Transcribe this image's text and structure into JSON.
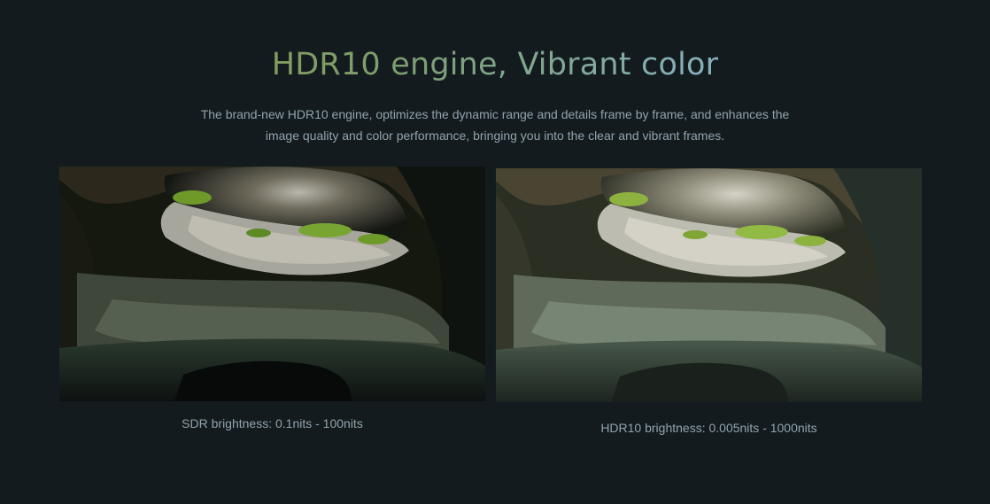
{
  "hero": {
    "title": "HDR10 engine, Vibrant color",
    "description_line1": "The brand-new HDR10 engine, optimizes the dynamic range and details frame by frame, and enhances the",
    "description_line2": "image quality and color performance, bringing you into the clear and vibrant frames."
  },
  "comparison": {
    "sdr_caption": "SDR brightness: 0.1nits - 100nits",
    "hdr_caption": "HDR10 brightness: 0.005nits - 1000nits"
  },
  "colors": {
    "background": "#141b1f",
    "text_muted": "#8fa3ab",
    "title_gradient_start": "#8d9a3e",
    "title_gradient_end": "#9ac6dd"
  }
}
